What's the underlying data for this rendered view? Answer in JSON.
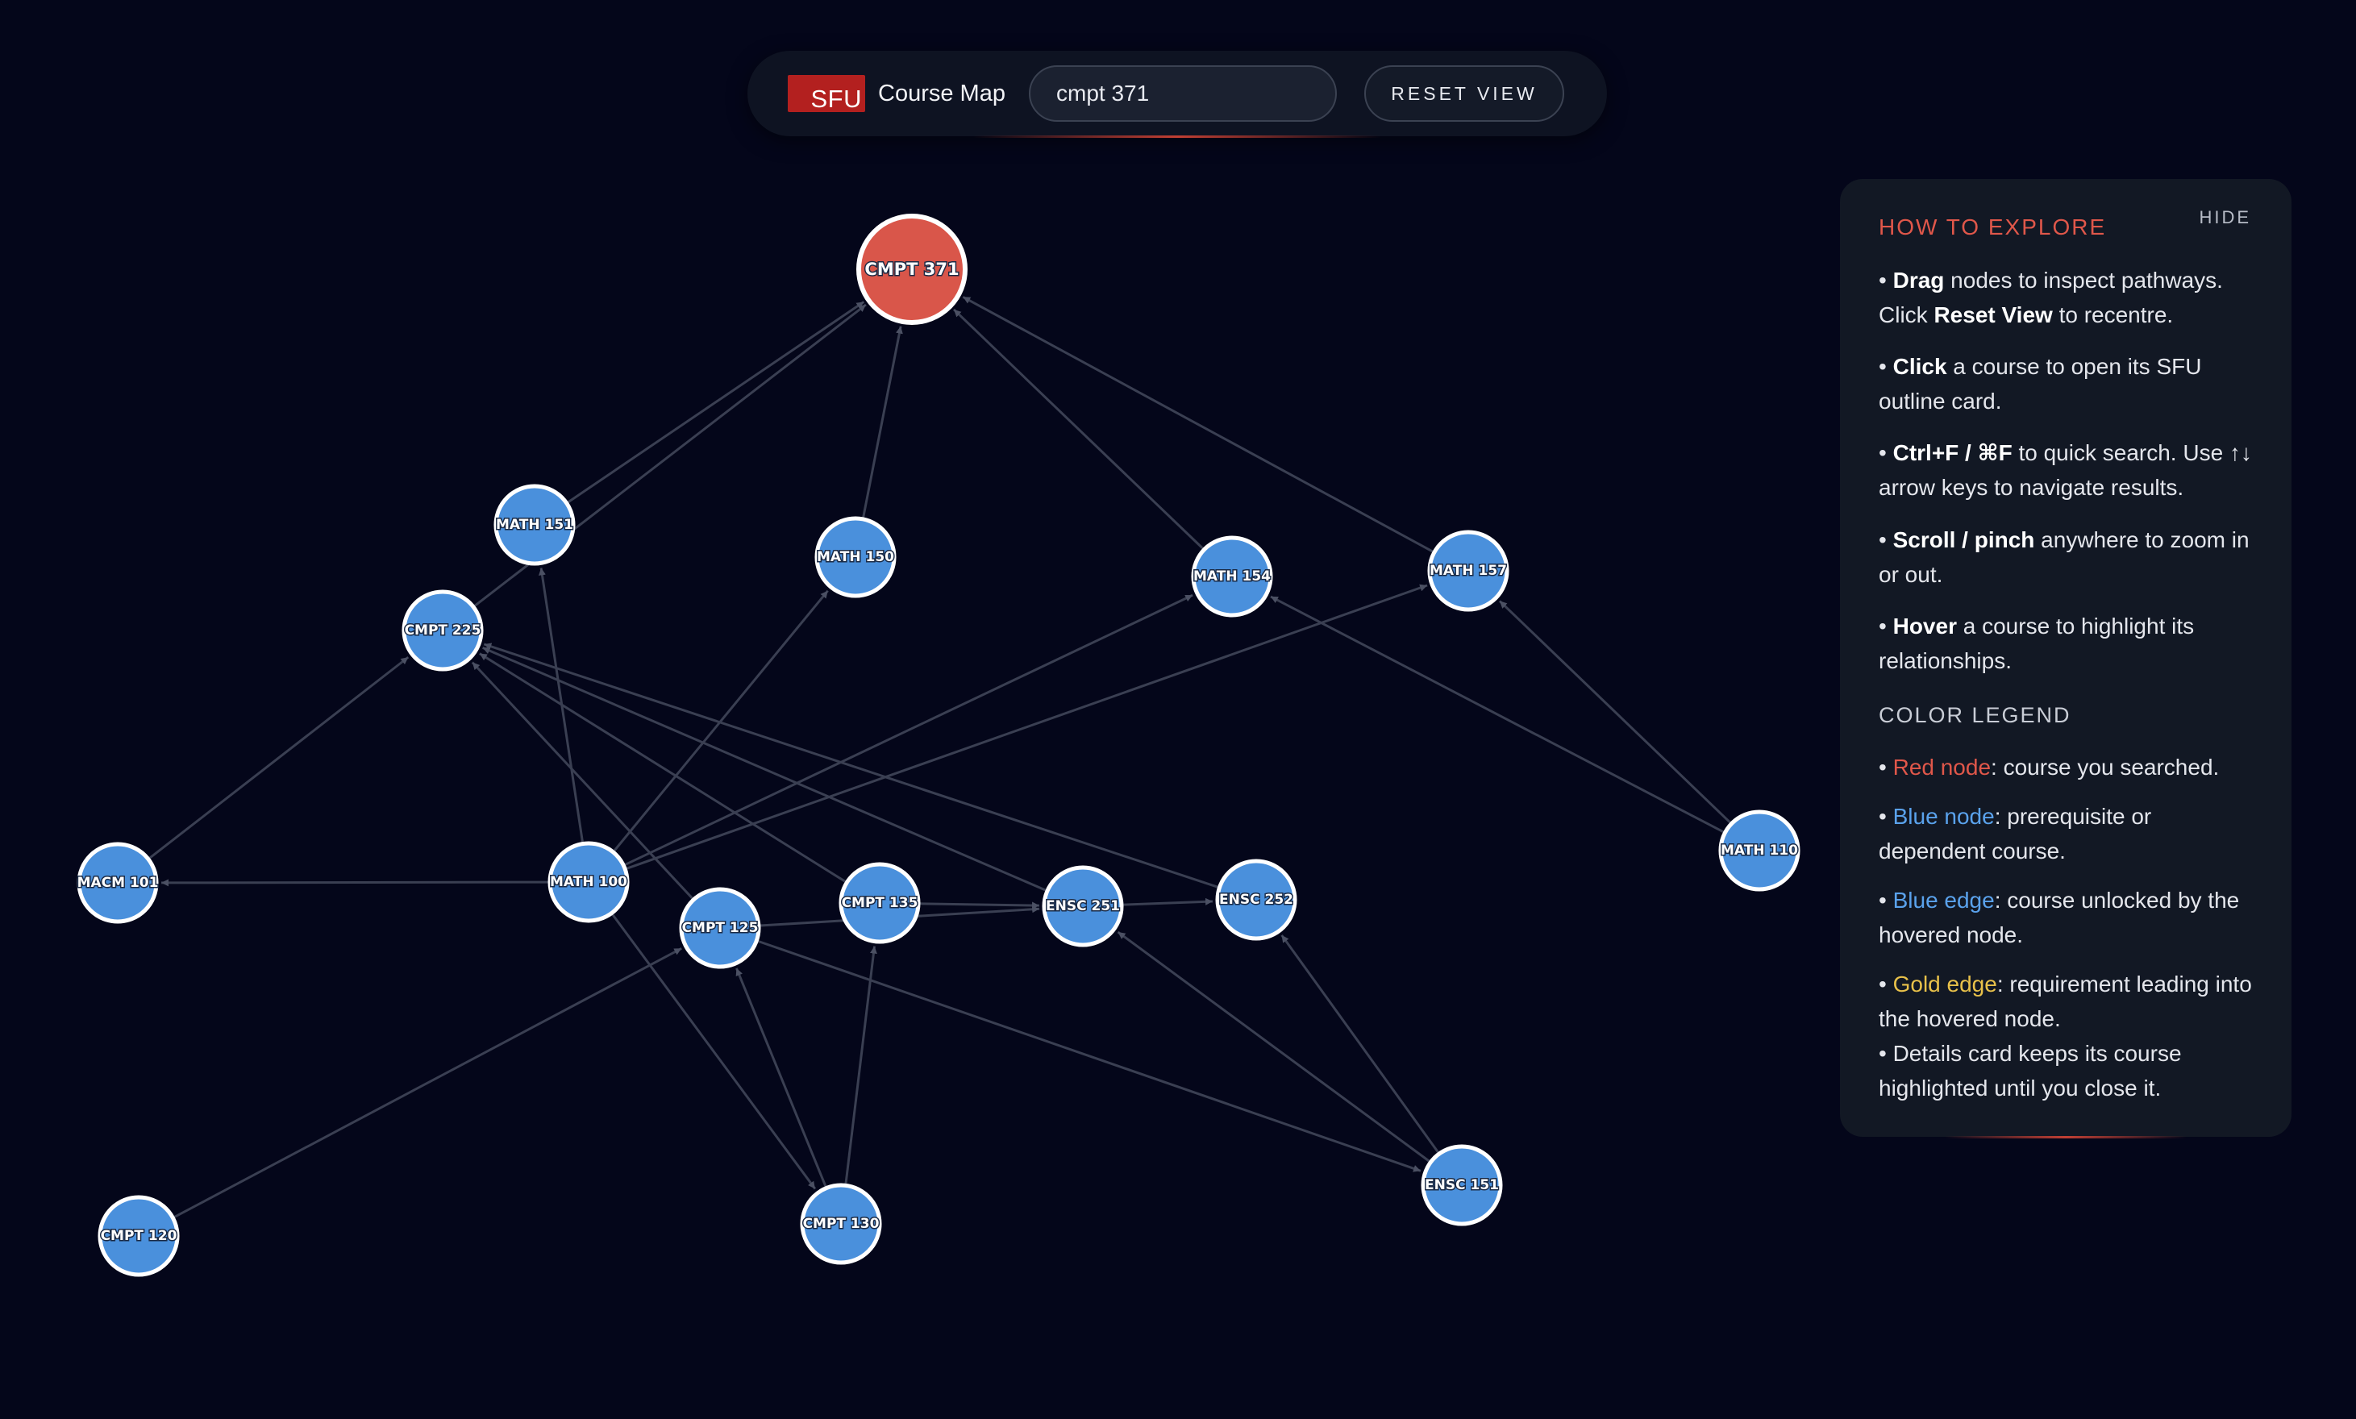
{
  "topbar": {
    "logo_text": "SFU",
    "title": "Course Map",
    "search_value": "cmpt 371",
    "reset_label": "RESET VIEW"
  },
  "colors": {
    "background": "#04061a",
    "searched_node": "#d9564a",
    "node": "#4a90dc",
    "node_border": "#ffffff",
    "edge": "#3a3f52",
    "accent": "#e0574a"
  },
  "graph": {
    "searched": "CMPT 371",
    "nodes": [
      {
        "id": "CMPT 371",
        "type": "searched"
      },
      {
        "id": "MATH 151",
        "type": "normal"
      },
      {
        "id": "MATH 150",
        "type": "normal"
      },
      {
        "id": "MATH 154",
        "type": "normal"
      },
      {
        "id": "MATH 157",
        "type": "normal"
      },
      {
        "id": "CMPT 225",
        "type": "normal"
      },
      {
        "id": "MACM 101",
        "type": "normal"
      },
      {
        "id": "MATH 100",
        "type": "normal"
      },
      {
        "id": "CMPT 125",
        "type": "normal"
      },
      {
        "id": "CMPT 135",
        "type": "normal"
      },
      {
        "id": "ENSC 251",
        "type": "normal"
      },
      {
        "id": "ENSC 252",
        "type": "normal"
      },
      {
        "id": "MATH 110",
        "type": "normal"
      },
      {
        "id": "CMPT 120",
        "type": "normal"
      },
      {
        "id": "CMPT 130",
        "type": "normal"
      },
      {
        "id": "ENSC 151",
        "type": "normal"
      }
    ],
    "edges": [
      {
        "from": "MATH 151",
        "to": "CMPT 371"
      },
      {
        "from": "CMPT 225",
        "to": "CMPT 371"
      },
      {
        "from": "MATH 150",
        "to": "CMPT 371"
      },
      {
        "from": "MATH 154",
        "to": "CMPT 371"
      },
      {
        "from": "MATH 157",
        "to": "CMPT 371"
      },
      {
        "from": "MACM 101",
        "to": "CMPT 225"
      },
      {
        "from": "MATH 100",
        "to": "MATH 151"
      },
      {
        "from": "MATH 100",
        "to": "MATH 150"
      },
      {
        "from": "MATH 100",
        "to": "MATH 154"
      },
      {
        "from": "MATH 100",
        "to": "MATH 157"
      },
      {
        "from": "MATH 100",
        "to": "MACM 101"
      },
      {
        "from": "MATH 100",
        "to": "CMPT 130"
      },
      {
        "from": "MATH 110",
        "to": "MATH 154"
      },
      {
        "from": "MATH 110",
        "to": "MATH 157"
      },
      {
        "from": "CMPT 125",
        "to": "CMPT 225"
      },
      {
        "from": "CMPT 135",
        "to": "CMPT 225"
      },
      {
        "from": "ENSC 251",
        "to": "CMPT 225"
      },
      {
        "from": "ENSC 252",
        "to": "CMPT 225"
      },
      {
        "from": "CMPT 125",
        "to": "ENSC 251"
      },
      {
        "from": "CMPT 135",
        "to": "ENSC 251"
      },
      {
        "from": "ENSC 251",
        "to": "ENSC 252"
      },
      {
        "from": "CMPT 120",
        "to": "CMPT 125"
      },
      {
        "from": "CMPT 130",
        "to": "CMPT 125"
      },
      {
        "from": "CMPT 130",
        "to": "CMPT 135"
      },
      {
        "from": "ENSC 151",
        "to": "ENSC 251"
      },
      {
        "from": "ENSC 151",
        "to": "ENSC 252"
      },
      {
        "from": "CMPT 125",
        "to": "ENSC 151"
      }
    ]
  },
  "help": {
    "title": "HOW TO EXPLORE",
    "hide_label": "HIDE",
    "tips": [
      {
        "parts": [
          "• ",
          "Drag",
          " nodes to inspect pathways. Click ",
          "Reset View",
          " to recentre."
        ]
      },
      {
        "parts": [
          "• ",
          "Click",
          " a course to open its SFU outline card."
        ]
      },
      {
        "parts": [
          "• ",
          "Ctrl+F / ⌘F",
          " to quick search. Use ↑↓ arrow keys to navigate results."
        ]
      },
      {
        "parts": [
          "• ",
          "Scroll / pinch",
          " anywhere to zoom in or out."
        ]
      },
      {
        "parts": [
          "• ",
          "Hover",
          " a course to highlight its relationships."
        ]
      }
    ],
    "legend_title": "COLOR LEGEND",
    "legend": [
      {
        "lead": "• ",
        "colored": "Red node",
        "rest": ": course you searched.",
        "color": "red"
      },
      {
        "lead": "• ",
        "colored": "Blue node",
        "rest": ": prerequisite or dependent course.",
        "color": "blue"
      },
      {
        "lead": "• ",
        "colored": "Blue edge",
        "rest": ": course unlocked by the hovered node.",
        "color": "blue"
      },
      {
        "lead": "• ",
        "colored": "Gold edge",
        "rest": ": requirement leading into the hovered node.",
        "color": "gold"
      }
    ],
    "note": "• Details card keeps its course highlighted until you close it."
  }
}
